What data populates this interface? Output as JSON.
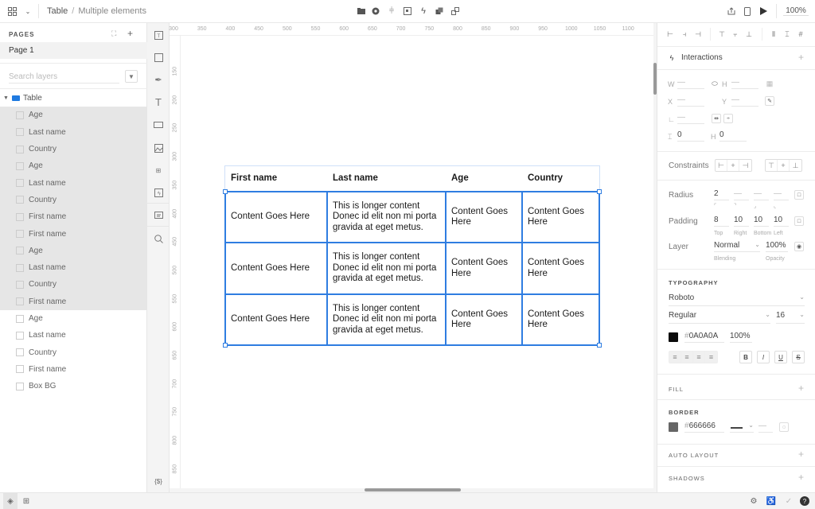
{
  "topbar": {
    "breadcrumb": [
      "Table",
      "Multiple elements"
    ],
    "zoom": "100%",
    "center_icons": [
      "folder-icon",
      "component-icon",
      "distribute-icon",
      "frame-icon",
      "interaction-icon",
      "group-icon",
      "ungroup-icon"
    ],
    "right_icons": [
      "share-icon",
      "device-preview-icon",
      "play-icon"
    ]
  },
  "left_panel": {
    "pages_label": "PAGES",
    "current_page": "Page 1",
    "search_placeholder": "Search layers",
    "layers": [
      {
        "name": "Table",
        "type": "group"
      },
      {
        "name": "Age",
        "selected": true
      },
      {
        "name": "Last name",
        "selected": true
      },
      {
        "name": "Country",
        "selected": true
      },
      {
        "name": "Age",
        "selected": true
      },
      {
        "name": "Last name",
        "selected": true
      },
      {
        "name": "Country",
        "selected": true
      },
      {
        "name": "First name",
        "selected": true
      },
      {
        "name": "First name",
        "selected": true
      },
      {
        "name": "Age",
        "selected": true
      },
      {
        "name": "Last name",
        "selected": true
      },
      {
        "name": "Country",
        "selected": true
      },
      {
        "name": "First name",
        "selected": true
      },
      {
        "name": "Age",
        "selected": false
      },
      {
        "name": "Last name",
        "selected": false
      },
      {
        "name": "Country",
        "selected": false
      },
      {
        "name": "First name",
        "selected": false
      },
      {
        "name": "Box BG",
        "selected": false
      }
    ]
  },
  "tools": [
    "text-box-icon",
    "rectangle-icon",
    "pen-icon",
    "text-icon",
    "button-icon",
    "image-icon",
    "components-icon",
    "interaction-icon",
    "comment-icon",
    "search-icon",
    "variables-icon"
  ],
  "tools_variables_label": "{$}",
  "rulers": {
    "horizontal": [
      "300",
      "350",
      "400",
      "450",
      "500",
      "550",
      "600",
      "650",
      "700",
      "750",
      "800",
      "850",
      "900",
      "950",
      "1000",
      "1050",
      "1100",
      "11"
    ],
    "vertical": [
      "150",
      "200",
      "250",
      "300",
      "350",
      "400",
      "450",
      "500",
      "550",
      "600",
      "650",
      "700",
      "750",
      "800",
      "850",
      "900"
    ]
  },
  "table": {
    "headers": [
      "First name",
      "Last name",
      "Age",
      "Country"
    ],
    "rows": [
      [
        "Content Goes Here",
        "This is longer content Donec id elit non mi porta gravida at eget metus.",
        "Content Goes Here",
        "Content Goes Here"
      ],
      [
        "Content Goes Here",
        "This is longer content Donec id elit non mi porta gravida at eget metus.",
        "Content Goes Here",
        "Content Goes Here"
      ],
      [
        "Content Goes Here",
        "This is longer content Donec id elit non mi porta gravida at eget metus.",
        "Content Goes Here",
        "Content Goes Here"
      ]
    ],
    "selection_color": "#2F7DE1"
  },
  "right_panel": {
    "interactions_label": "Interactions",
    "w_label": "W",
    "w_value": "—",
    "h_label": "H",
    "h_value": "—",
    "x_label": "X",
    "x_value": "—",
    "y_label": "Y",
    "y_value": "—",
    "rotation_value": "—",
    "spacing_x_value": "0",
    "spacing_y_value": "0",
    "constraints_label": "Constraints",
    "radius_label": "Radius",
    "radius_values": [
      "2",
      "—",
      "—",
      "—"
    ],
    "padding_label": "Padding",
    "padding_values": [
      "8",
      "10",
      "10",
      "10"
    ],
    "padding_sublabels": [
      "Top",
      "Right",
      "Bottom",
      "Left"
    ],
    "layer_label": "Layer",
    "blending_value": "Normal",
    "blending_sublabel": "Blending",
    "opacity_value": "100%",
    "opacity_sublabel": "Opacity",
    "typography_header": "TYPOGRAPHY",
    "font_family": "Roboto",
    "font_weight": "Regular",
    "font_size": "16",
    "text_color_hex": "0A0A0A",
    "text_color": "#0A0A0A",
    "text_opacity": "100%",
    "fill_header": "FILL",
    "border_header": "BORDER",
    "border_color_hex": "666666",
    "border_color": "#666666",
    "border_width": "—",
    "auto_layout_header": "AUTO LAYOUT",
    "shadows_header": "SHADOWS"
  },
  "bottombar": {
    "left_icons": [
      "layers-icon",
      "assets-icon"
    ],
    "right_icons": [
      "settings-icon",
      "accessibility-icon",
      "check-icon",
      "help-icon"
    ]
  }
}
